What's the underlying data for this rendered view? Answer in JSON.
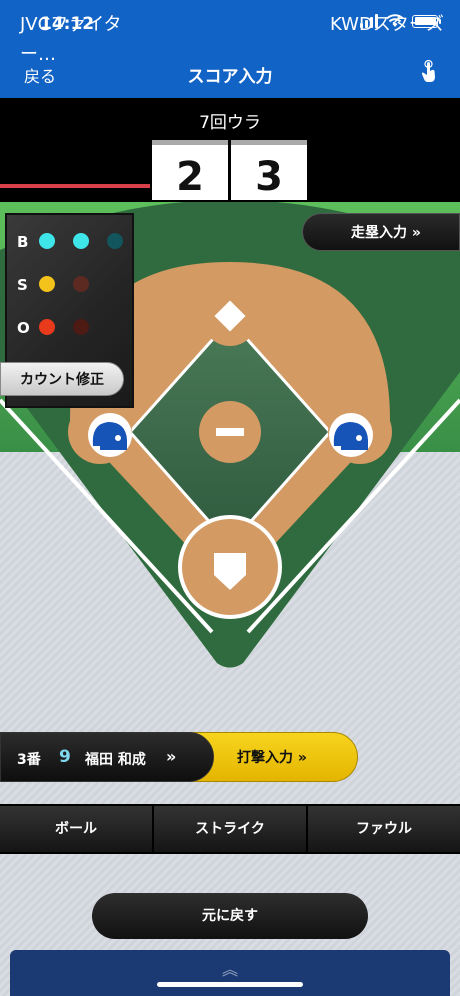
{
  "status": {
    "time": "14:12"
  },
  "nav": {
    "back": "戻る",
    "title": "スコア入力"
  },
  "score": {
    "away_team": "JVCファイター…",
    "home_team": "KWDスターズ",
    "inning": "7回ウラ",
    "away_score": "2",
    "home_score": "3"
  },
  "count": {
    "b_label": "B",
    "s_label": "S",
    "o_label": "O",
    "balls": 2,
    "strikes": 1,
    "outs": 1
  },
  "buttons": {
    "count_fix": "カウント修正",
    "runner_input": "走塁入力 »",
    "bat_input": "打撃入力 »",
    "ball": "ボール",
    "strike": "ストライク",
    "foul": "ファウル",
    "undo": "元に戻す"
  },
  "batter": {
    "order": "3番",
    "number": "9",
    "name": "福田 和成",
    "arrow": "»"
  },
  "colors": {
    "nav_blue": "#1263c6",
    "ball_on": "#3ee6ea",
    "strike_on": "#f3c21b",
    "out_on": "#ea3a1c",
    "field_green": "#3c8a4a",
    "dirt": "#d39a63"
  }
}
